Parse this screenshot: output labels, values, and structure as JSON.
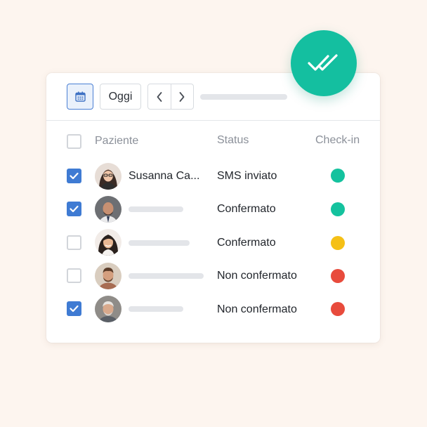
{
  "toolbar": {
    "calendar_icon": "calendar-icon",
    "today_label": "Oggi",
    "prev_icon": "chevron-left-icon",
    "next_icon": "chevron-right-icon"
  },
  "table": {
    "headers": {
      "patient": "Paziente",
      "status": "Status",
      "checkin": "Check-in"
    },
    "rows": [
      {
        "checked": true,
        "name": "Susanna Ca...",
        "status": "SMS inviato",
        "checkin_color": "#14c29e"
      },
      {
        "checked": true,
        "name": "",
        "status": "Confermato",
        "checkin_color": "#14c29e"
      },
      {
        "checked": false,
        "name": "",
        "status": "Confermato",
        "checkin_color": "#f5c016"
      },
      {
        "checked": false,
        "name": "",
        "status": "Non confermato",
        "checkin_color": "#e84b3c"
      },
      {
        "checked": true,
        "name": "",
        "status": "Non confermato",
        "checkin_color": "#e84b3c"
      }
    ]
  },
  "badge_icon": "double-check-icon",
  "colors": {
    "accent": "#3f7bd3",
    "badge": "#14bfa0",
    "background": "#fdf5ef"
  }
}
